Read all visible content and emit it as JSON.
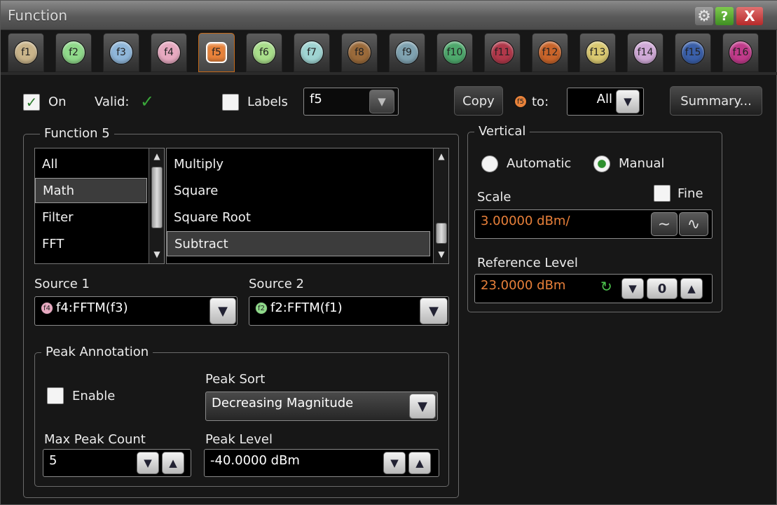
{
  "window": {
    "title": "Function"
  },
  "titlebar_buttons": {
    "help": "?",
    "close": "X"
  },
  "tabs": [
    {
      "label": "f1",
      "color": "#c9b48a"
    },
    {
      "label": "f2",
      "color": "#8fd98a"
    },
    {
      "label": "f3",
      "color": "#8fb6d9"
    },
    {
      "label": "f4",
      "color": "#e7a9c0"
    },
    {
      "label": "f5",
      "color": "#e8823a"
    },
    {
      "label": "f6",
      "color": "#a8dd8a"
    },
    {
      "label": "f7",
      "color": "#9fd4d2"
    },
    {
      "label": "f8",
      "color": "#9a6a3a"
    },
    {
      "label": "f9",
      "color": "#7fa2b0"
    },
    {
      "label": "f10",
      "color": "#4ea86c"
    },
    {
      "label": "f11",
      "color": "#b0384a"
    },
    {
      "label": "f12",
      "color": "#c8642a"
    },
    {
      "label": "f13",
      "color": "#d9c870"
    },
    {
      "label": "f14",
      "color": "#cfa9d6"
    },
    {
      "label": "f15",
      "color": "#3a5fa8"
    },
    {
      "label": "f16",
      "color": "#c03a8a"
    }
  ],
  "active_tab": "f5",
  "top_row": {
    "on_label": "On",
    "valid_label": "Valid:",
    "labels_label": "Labels",
    "labels_value": "f5",
    "copy_label": "Copy",
    "copy_badge": "f5",
    "to_label": "to:",
    "to_value": "All",
    "summary_label": "Summary..."
  },
  "function_group": {
    "title": "Function 5",
    "categories": [
      "All",
      "Math",
      "Filter",
      "FFT"
    ],
    "selected_category": "Math",
    "operations": [
      "Multiply",
      "Square",
      "Square Root",
      "Subtract"
    ],
    "selected_operation": "Subtract",
    "source1_label": "Source 1",
    "source1_badge": "f4",
    "source1_value": "f4:FFTM(f3)",
    "source2_label": "Source 2",
    "source2_badge": "f2",
    "source2_value": "f2:FFTM(f1)"
  },
  "peak_group": {
    "title": "Peak Annotation",
    "enable_label": "Enable",
    "sort_label": "Peak Sort",
    "sort_value": "Decreasing Magnitude",
    "max_count_label": "Max Peak Count",
    "max_count_value": "5",
    "level_label": "Peak Level",
    "level_value": "-40.0000 dBm"
  },
  "vertical_group": {
    "title": "Vertical",
    "automatic_label": "Automatic",
    "manual_label": "Manual",
    "mode": "Manual",
    "scale_label": "Scale",
    "fine_label": "Fine",
    "scale_value": "3.00000 dBm/",
    "ref_label": "Reference Level",
    "ref_value": "23.0000 dBm"
  },
  "colors": {
    "accent_orange": "#e8803a",
    "check_green": "#2d8f2d"
  }
}
